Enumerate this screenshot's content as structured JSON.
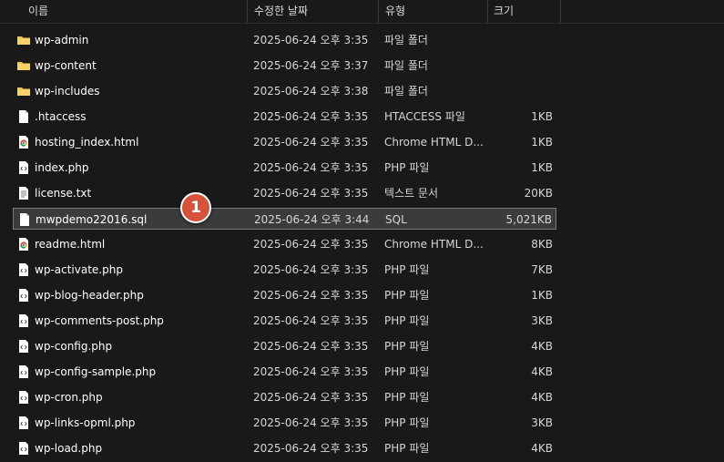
{
  "header": {
    "name": "이름",
    "date": "수정한 날짜",
    "type": "유형",
    "size": "크기",
    "sort_arrow": "^"
  },
  "colors": {
    "background": "#191919",
    "folder": "#f2c451",
    "badge": "#d5533a",
    "selected_row": "#3b3b3b"
  },
  "files": [
    {
      "name": "wp-admin",
      "date": "2025-06-24 오후 3:35",
      "type": "파일 폴더",
      "size": "",
      "icon": "folder-icon"
    },
    {
      "name": "wp-content",
      "date": "2025-06-24 오후 3:37",
      "type": "파일 폴더",
      "size": "",
      "icon": "folder-icon"
    },
    {
      "name": "wp-includes",
      "date": "2025-06-24 오후 3:38",
      "type": "파일 폴더",
      "size": "",
      "icon": "folder-icon"
    },
    {
      "name": ".htaccess",
      "date": "2025-06-24 오후 3:35",
      "type": "HTACCESS 파일",
      "size": "1KB",
      "icon": "file-icon"
    },
    {
      "name": "hosting_index.html",
      "date": "2025-06-24 오후 3:35",
      "type": "Chrome HTML D...",
      "size": "1KB",
      "icon": "chrome-html-icon"
    },
    {
      "name": "index.php",
      "date": "2025-06-24 오후 3:35",
      "type": "PHP 파일",
      "size": "1KB",
      "icon": "php-file-icon"
    },
    {
      "name": "license.txt",
      "date": "2025-06-24 오후 3:35",
      "type": "텍스트 문서",
      "size": "20KB",
      "icon": "text-file-icon"
    },
    {
      "name": "mwpdemo22016.sql",
      "date": "2025-06-24 오후 3:44",
      "type": "SQL",
      "size": "5,021KB",
      "icon": "file-icon",
      "selected": true
    },
    {
      "name": "readme.html",
      "date": "2025-06-24 오후 3:35",
      "type": "Chrome HTML D...",
      "size": "8KB",
      "icon": "chrome-html-icon"
    },
    {
      "name": "wp-activate.php",
      "date": "2025-06-24 오후 3:35",
      "type": "PHP 파일",
      "size": "7KB",
      "icon": "php-file-icon"
    },
    {
      "name": "wp-blog-header.php",
      "date": "2025-06-24 오후 3:35",
      "type": "PHP 파일",
      "size": "1KB",
      "icon": "php-file-icon"
    },
    {
      "name": "wp-comments-post.php",
      "date": "2025-06-24 오후 3:35",
      "type": "PHP 파일",
      "size": "3KB",
      "icon": "php-file-icon"
    },
    {
      "name": "wp-config.php",
      "date": "2025-06-24 오후 3:35",
      "type": "PHP 파일",
      "size": "4KB",
      "icon": "php-file-icon"
    },
    {
      "name": "wp-config-sample.php",
      "date": "2025-06-24 오후 3:35",
      "type": "PHP 파일",
      "size": "4KB",
      "icon": "php-file-icon"
    },
    {
      "name": "wp-cron.php",
      "date": "2025-06-24 오후 3:35",
      "type": "PHP 파일",
      "size": "4KB",
      "icon": "php-file-icon"
    },
    {
      "name": "wp-links-opml.php",
      "date": "2025-06-24 오후 3:35",
      "type": "PHP 파일",
      "size": "3KB",
      "icon": "php-file-icon"
    },
    {
      "name": "wp-load.php",
      "date": "2025-06-24 오후 3:35",
      "type": "PHP 파일",
      "size": "4KB",
      "icon": "php-file-icon"
    }
  ],
  "callout": {
    "label": "1"
  }
}
